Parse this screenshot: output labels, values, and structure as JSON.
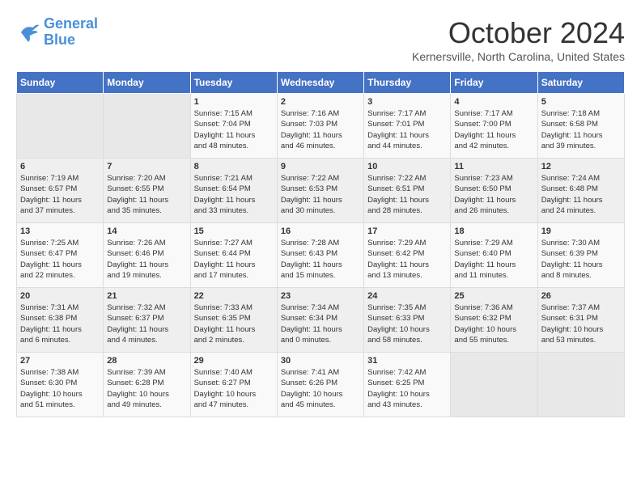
{
  "header": {
    "logo_line1": "General",
    "logo_line2": "Blue",
    "month": "October 2024",
    "location": "Kernersville, North Carolina, United States"
  },
  "days_of_week": [
    "Sunday",
    "Monday",
    "Tuesday",
    "Wednesday",
    "Thursday",
    "Friday",
    "Saturday"
  ],
  "weeks": [
    [
      {
        "day": "",
        "info": ""
      },
      {
        "day": "",
        "info": ""
      },
      {
        "day": "1",
        "info": "Sunrise: 7:15 AM\nSunset: 7:04 PM\nDaylight: 11 hours\nand 48 minutes."
      },
      {
        "day": "2",
        "info": "Sunrise: 7:16 AM\nSunset: 7:03 PM\nDaylight: 11 hours\nand 46 minutes."
      },
      {
        "day": "3",
        "info": "Sunrise: 7:17 AM\nSunset: 7:01 PM\nDaylight: 11 hours\nand 44 minutes."
      },
      {
        "day": "4",
        "info": "Sunrise: 7:17 AM\nSunset: 7:00 PM\nDaylight: 11 hours\nand 42 minutes."
      },
      {
        "day": "5",
        "info": "Sunrise: 7:18 AM\nSunset: 6:58 PM\nDaylight: 11 hours\nand 39 minutes."
      }
    ],
    [
      {
        "day": "6",
        "info": "Sunrise: 7:19 AM\nSunset: 6:57 PM\nDaylight: 11 hours\nand 37 minutes."
      },
      {
        "day": "7",
        "info": "Sunrise: 7:20 AM\nSunset: 6:55 PM\nDaylight: 11 hours\nand 35 minutes."
      },
      {
        "day": "8",
        "info": "Sunrise: 7:21 AM\nSunset: 6:54 PM\nDaylight: 11 hours\nand 33 minutes."
      },
      {
        "day": "9",
        "info": "Sunrise: 7:22 AM\nSunset: 6:53 PM\nDaylight: 11 hours\nand 30 minutes."
      },
      {
        "day": "10",
        "info": "Sunrise: 7:22 AM\nSunset: 6:51 PM\nDaylight: 11 hours\nand 28 minutes."
      },
      {
        "day": "11",
        "info": "Sunrise: 7:23 AM\nSunset: 6:50 PM\nDaylight: 11 hours\nand 26 minutes."
      },
      {
        "day": "12",
        "info": "Sunrise: 7:24 AM\nSunset: 6:48 PM\nDaylight: 11 hours\nand 24 minutes."
      }
    ],
    [
      {
        "day": "13",
        "info": "Sunrise: 7:25 AM\nSunset: 6:47 PM\nDaylight: 11 hours\nand 22 minutes."
      },
      {
        "day": "14",
        "info": "Sunrise: 7:26 AM\nSunset: 6:46 PM\nDaylight: 11 hours\nand 19 minutes."
      },
      {
        "day": "15",
        "info": "Sunrise: 7:27 AM\nSunset: 6:44 PM\nDaylight: 11 hours\nand 17 minutes."
      },
      {
        "day": "16",
        "info": "Sunrise: 7:28 AM\nSunset: 6:43 PM\nDaylight: 11 hours\nand 15 minutes."
      },
      {
        "day": "17",
        "info": "Sunrise: 7:29 AM\nSunset: 6:42 PM\nDaylight: 11 hours\nand 13 minutes."
      },
      {
        "day": "18",
        "info": "Sunrise: 7:29 AM\nSunset: 6:40 PM\nDaylight: 11 hours\nand 11 minutes."
      },
      {
        "day": "19",
        "info": "Sunrise: 7:30 AM\nSunset: 6:39 PM\nDaylight: 11 hours\nand 8 minutes."
      }
    ],
    [
      {
        "day": "20",
        "info": "Sunrise: 7:31 AM\nSunset: 6:38 PM\nDaylight: 11 hours\nand 6 minutes."
      },
      {
        "day": "21",
        "info": "Sunrise: 7:32 AM\nSunset: 6:37 PM\nDaylight: 11 hours\nand 4 minutes."
      },
      {
        "day": "22",
        "info": "Sunrise: 7:33 AM\nSunset: 6:35 PM\nDaylight: 11 hours\nand 2 minutes."
      },
      {
        "day": "23",
        "info": "Sunrise: 7:34 AM\nSunset: 6:34 PM\nDaylight: 11 hours\nand 0 minutes."
      },
      {
        "day": "24",
        "info": "Sunrise: 7:35 AM\nSunset: 6:33 PM\nDaylight: 10 hours\nand 58 minutes."
      },
      {
        "day": "25",
        "info": "Sunrise: 7:36 AM\nSunset: 6:32 PM\nDaylight: 10 hours\nand 55 minutes."
      },
      {
        "day": "26",
        "info": "Sunrise: 7:37 AM\nSunset: 6:31 PM\nDaylight: 10 hours\nand 53 minutes."
      }
    ],
    [
      {
        "day": "27",
        "info": "Sunrise: 7:38 AM\nSunset: 6:30 PM\nDaylight: 10 hours\nand 51 minutes."
      },
      {
        "day": "28",
        "info": "Sunrise: 7:39 AM\nSunset: 6:28 PM\nDaylight: 10 hours\nand 49 minutes."
      },
      {
        "day": "29",
        "info": "Sunrise: 7:40 AM\nSunset: 6:27 PM\nDaylight: 10 hours\nand 47 minutes."
      },
      {
        "day": "30",
        "info": "Sunrise: 7:41 AM\nSunset: 6:26 PM\nDaylight: 10 hours\nand 45 minutes."
      },
      {
        "day": "31",
        "info": "Sunrise: 7:42 AM\nSunset: 6:25 PM\nDaylight: 10 hours\nand 43 minutes."
      },
      {
        "day": "",
        "info": ""
      },
      {
        "day": "",
        "info": ""
      }
    ]
  ]
}
